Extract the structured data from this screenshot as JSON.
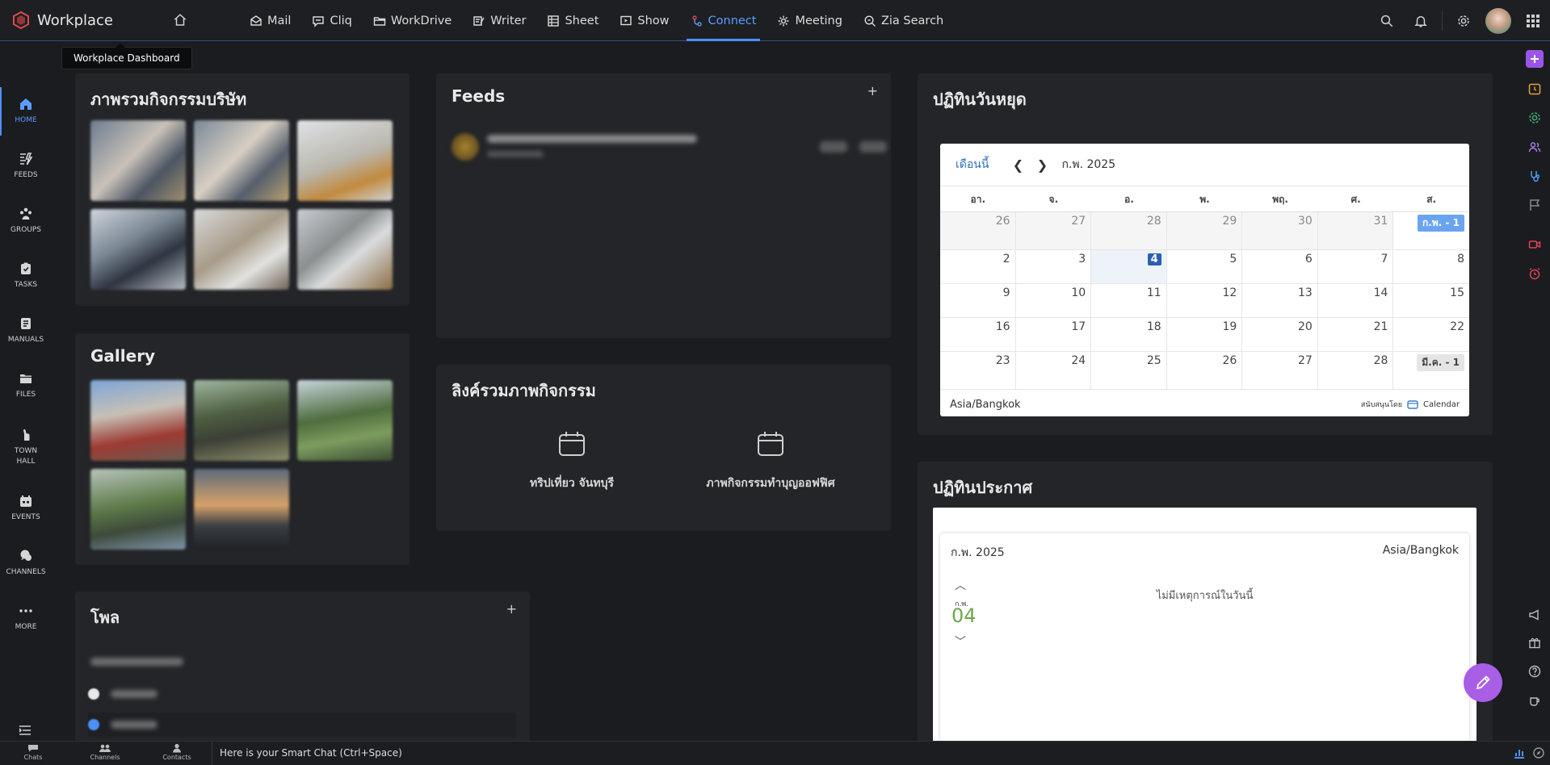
{
  "brand": {
    "name": "Workplace",
    "logo_color": "#e04848"
  },
  "tooltip": {
    "text": "Workplace Dashboard"
  },
  "topnav": [
    {
      "label": "Mail",
      "icon": "mail-icon"
    },
    {
      "label": "Cliq",
      "icon": "chat-icon"
    },
    {
      "label": "WorkDrive",
      "icon": "folder-icon"
    },
    {
      "label": "Writer",
      "icon": "writer-icon"
    },
    {
      "label": "Sheet",
      "icon": "sheet-icon"
    },
    {
      "label": "Show",
      "icon": "presentation-icon"
    },
    {
      "label": "Connect",
      "icon": "connect-icon",
      "active": true
    },
    {
      "label": "Meeting",
      "icon": "meeting-icon"
    },
    {
      "label": "Zia Search",
      "icon": "zia-search-icon"
    }
  ],
  "accent": "#4e8ff5",
  "sidebar": [
    {
      "label": "HOME",
      "icon": "home-icon",
      "active": true
    },
    {
      "label": "FEEDS",
      "icon": "feeds-icon"
    },
    {
      "label": "GROUPS",
      "icon": "groups-icon"
    },
    {
      "label": "TASKS",
      "icon": "tasks-icon"
    },
    {
      "label": "MANUALS",
      "icon": "manuals-icon"
    },
    {
      "label": "FILES",
      "icon": "files-icon"
    },
    {
      "label": "TOWN\nHALL",
      "icon": "town-hall-icon"
    },
    {
      "label": "EVENTS",
      "icon": "events-icon"
    },
    {
      "label": "CHANNELS",
      "icon": "channels-icon"
    },
    {
      "label": "MORE",
      "icon": "more-icon"
    }
  ],
  "cards": {
    "activities": {
      "title": "ภาพรวมกิจกรรมบริษัท"
    },
    "feeds": {
      "title": "Feeds",
      "plus": "+"
    },
    "gallery": {
      "title": "Gallery"
    },
    "links": {
      "title": "ลิงค์รวมภาพกิจกรรม",
      "items": [
        "ทริปเที่ยว จันทบุรี",
        "ภาพกิจกรรมทำบุญออฟฟิศ"
      ]
    },
    "poll": {
      "title": "โพล",
      "plus": "+"
    },
    "holiday": {
      "title": "ปฏิทินวันหยุด"
    },
    "announce": {
      "title": "ปฏิทินประกาศ"
    }
  },
  "holiday_calendar": {
    "today_label": "เดือนนี้",
    "month_label": "ก.พ. 2025",
    "weekdays": [
      "อา.",
      "จ.",
      "อ.",
      "พ.",
      "พฤ.",
      "ศ.",
      "ส."
    ],
    "weeks": [
      [
        {
          "d": "26",
          "prev": true
        },
        {
          "d": "27",
          "prev": true
        },
        {
          "d": "28",
          "prev": true
        },
        {
          "d": "29",
          "prev": true
        },
        {
          "d": "30",
          "prev": true
        },
        {
          "d": "31",
          "prev": true
        },
        {
          "d": "ก.พ. - 1",
          "badge": "blue"
        }
      ],
      [
        {
          "d": "2"
        },
        {
          "d": "3"
        },
        {
          "d": "4",
          "today": true
        },
        {
          "d": "5"
        },
        {
          "d": "6"
        },
        {
          "d": "7"
        },
        {
          "d": "8"
        }
      ],
      [
        {
          "d": "9"
        },
        {
          "d": "10"
        },
        {
          "d": "11"
        },
        {
          "d": "12"
        },
        {
          "d": "13"
        },
        {
          "d": "14"
        },
        {
          "d": "15"
        }
      ],
      [
        {
          "d": "16"
        },
        {
          "d": "17"
        },
        {
          "d": "18"
        },
        {
          "d": "19"
        },
        {
          "d": "20"
        },
        {
          "d": "21"
        },
        {
          "d": "22"
        }
      ],
      [
        {
          "d": "23"
        },
        {
          "d": "24"
        },
        {
          "d": "25"
        },
        {
          "d": "26"
        },
        {
          "d": "27"
        },
        {
          "d": "28"
        },
        {
          "d": "มี.ค. - 1",
          "badge": "grey"
        }
      ]
    ],
    "timezone": "Asia/Bangkok",
    "powered_by": "สนับสนุนโดย",
    "powered_brand": "Calendar"
  },
  "announce_calendar": {
    "month_label": "ก.พ. 2025",
    "timezone": "Asia/Bangkok",
    "day_month": "ก.พ.",
    "day_num": "04",
    "no_events": "ไม่มีเหตุการณ์ในวันนี้"
  },
  "bottombar": {
    "items": [
      "Chats",
      "Channels",
      "Contacts"
    ],
    "smart_chat": "Here is your Smart Chat (Ctrl+Space)"
  }
}
